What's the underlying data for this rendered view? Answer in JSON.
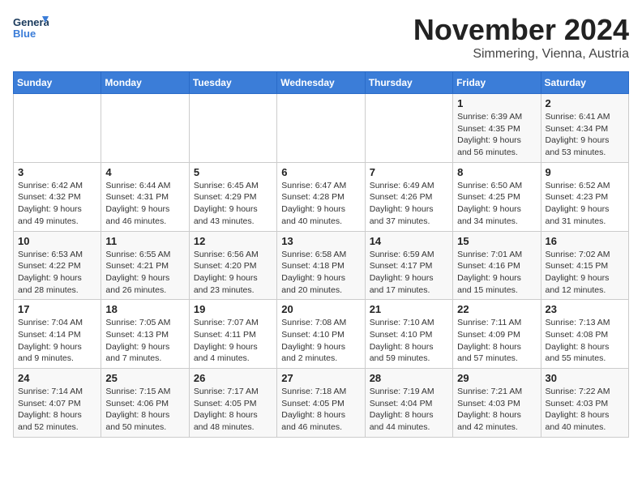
{
  "header": {
    "logo_general": "General",
    "logo_blue": "Blue",
    "month": "November 2024",
    "location": "Simmering, Vienna, Austria"
  },
  "weekdays": [
    "Sunday",
    "Monday",
    "Tuesday",
    "Wednesday",
    "Thursday",
    "Friday",
    "Saturday"
  ],
  "weeks": [
    [
      {
        "day": "",
        "info": ""
      },
      {
        "day": "",
        "info": ""
      },
      {
        "day": "",
        "info": ""
      },
      {
        "day": "",
        "info": ""
      },
      {
        "day": "",
        "info": ""
      },
      {
        "day": "1",
        "info": "Sunrise: 6:39 AM\nSunset: 4:35 PM\nDaylight: 9 hours\nand 56 minutes."
      },
      {
        "day": "2",
        "info": "Sunrise: 6:41 AM\nSunset: 4:34 PM\nDaylight: 9 hours\nand 53 minutes."
      }
    ],
    [
      {
        "day": "3",
        "info": "Sunrise: 6:42 AM\nSunset: 4:32 PM\nDaylight: 9 hours\nand 49 minutes."
      },
      {
        "day": "4",
        "info": "Sunrise: 6:44 AM\nSunset: 4:31 PM\nDaylight: 9 hours\nand 46 minutes."
      },
      {
        "day": "5",
        "info": "Sunrise: 6:45 AM\nSunset: 4:29 PM\nDaylight: 9 hours\nand 43 minutes."
      },
      {
        "day": "6",
        "info": "Sunrise: 6:47 AM\nSunset: 4:28 PM\nDaylight: 9 hours\nand 40 minutes."
      },
      {
        "day": "7",
        "info": "Sunrise: 6:49 AM\nSunset: 4:26 PM\nDaylight: 9 hours\nand 37 minutes."
      },
      {
        "day": "8",
        "info": "Sunrise: 6:50 AM\nSunset: 4:25 PM\nDaylight: 9 hours\nand 34 minutes."
      },
      {
        "day": "9",
        "info": "Sunrise: 6:52 AM\nSunset: 4:23 PM\nDaylight: 9 hours\nand 31 minutes."
      }
    ],
    [
      {
        "day": "10",
        "info": "Sunrise: 6:53 AM\nSunset: 4:22 PM\nDaylight: 9 hours\nand 28 minutes."
      },
      {
        "day": "11",
        "info": "Sunrise: 6:55 AM\nSunset: 4:21 PM\nDaylight: 9 hours\nand 26 minutes."
      },
      {
        "day": "12",
        "info": "Sunrise: 6:56 AM\nSunset: 4:20 PM\nDaylight: 9 hours\nand 23 minutes."
      },
      {
        "day": "13",
        "info": "Sunrise: 6:58 AM\nSunset: 4:18 PM\nDaylight: 9 hours\nand 20 minutes."
      },
      {
        "day": "14",
        "info": "Sunrise: 6:59 AM\nSunset: 4:17 PM\nDaylight: 9 hours\nand 17 minutes."
      },
      {
        "day": "15",
        "info": "Sunrise: 7:01 AM\nSunset: 4:16 PM\nDaylight: 9 hours\nand 15 minutes."
      },
      {
        "day": "16",
        "info": "Sunrise: 7:02 AM\nSunset: 4:15 PM\nDaylight: 9 hours\nand 12 minutes."
      }
    ],
    [
      {
        "day": "17",
        "info": "Sunrise: 7:04 AM\nSunset: 4:14 PM\nDaylight: 9 hours\nand 9 minutes."
      },
      {
        "day": "18",
        "info": "Sunrise: 7:05 AM\nSunset: 4:13 PM\nDaylight: 9 hours\nand 7 minutes."
      },
      {
        "day": "19",
        "info": "Sunrise: 7:07 AM\nSunset: 4:11 PM\nDaylight: 9 hours\nand 4 minutes."
      },
      {
        "day": "20",
        "info": "Sunrise: 7:08 AM\nSunset: 4:10 PM\nDaylight: 9 hours\nand 2 minutes."
      },
      {
        "day": "21",
        "info": "Sunrise: 7:10 AM\nSunset: 4:10 PM\nDaylight: 8 hours\nand 59 minutes."
      },
      {
        "day": "22",
        "info": "Sunrise: 7:11 AM\nSunset: 4:09 PM\nDaylight: 8 hours\nand 57 minutes."
      },
      {
        "day": "23",
        "info": "Sunrise: 7:13 AM\nSunset: 4:08 PM\nDaylight: 8 hours\nand 55 minutes."
      }
    ],
    [
      {
        "day": "24",
        "info": "Sunrise: 7:14 AM\nSunset: 4:07 PM\nDaylight: 8 hours\nand 52 minutes."
      },
      {
        "day": "25",
        "info": "Sunrise: 7:15 AM\nSunset: 4:06 PM\nDaylight: 8 hours\nand 50 minutes."
      },
      {
        "day": "26",
        "info": "Sunrise: 7:17 AM\nSunset: 4:05 PM\nDaylight: 8 hours\nand 48 minutes."
      },
      {
        "day": "27",
        "info": "Sunrise: 7:18 AM\nSunset: 4:05 PM\nDaylight: 8 hours\nand 46 minutes."
      },
      {
        "day": "28",
        "info": "Sunrise: 7:19 AM\nSunset: 4:04 PM\nDaylight: 8 hours\nand 44 minutes."
      },
      {
        "day": "29",
        "info": "Sunrise: 7:21 AM\nSunset: 4:03 PM\nDaylight: 8 hours\nand 42 minutes."
      },
      {
        "day": "30",
        "info": "Sunrise: 7:22 AM\nSunset: 4:03 PM\nDaylight: 8 hours\nand 40 minutes."
      }
    ]
  ]
}
